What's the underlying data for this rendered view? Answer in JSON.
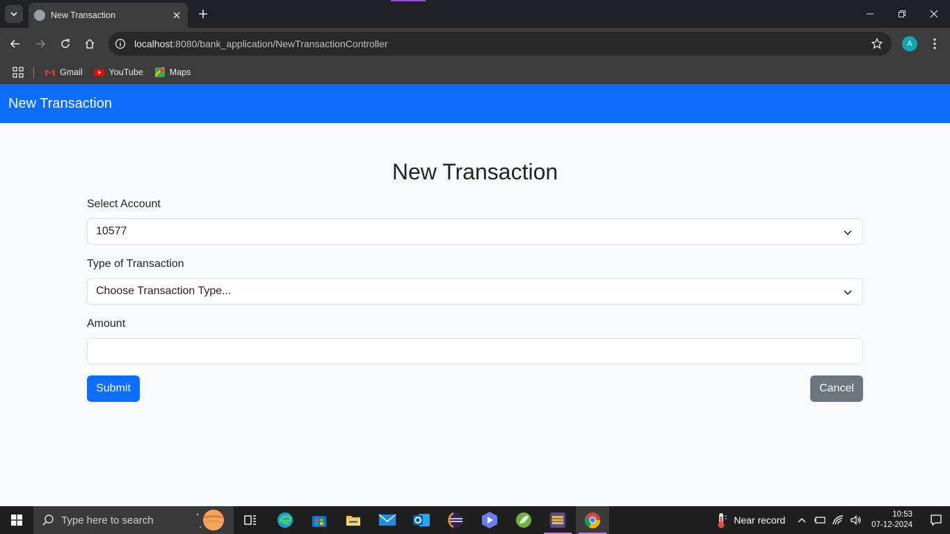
{
  "browser": {
    "tab_title": "New Transaction",
    "url_host": "localhost",
    "url_rest": ":8080/bank_application/NewTransactionController",
    "profile_initial": "A",
    "bookmarks": [
      {
        "label": "Gmail",
        "icon": "gmail-icon"
      },
      {
        "label": "YouTube",
        "icon": "youtube-icon"
      },
      {
        "label": "Maps",
        "icon": "maps-icon"
      }
    ]
  },
  "page": {
    "brand": "New Transaction",
    "title": "New Transaction",
    "form": {
      "account_label": "Select Account",
      "account_value": "10577",
      "type_label": "Type of Transaction",
      "type_value": "Choose Transaction Type...",
      "amount_label": "Amount",
      "amount_value": "",
      "submit_label": "Submit",
      "cancel_label": "Cancel"
    }
  },
  "taskbar": {
    "search_placeholder": "Type here to search",
    "apps": [
      "task-view-icon",
      "edge-icon",
      "store-icon",
      "file-explorer-icon",
      "mail-icon",
      "outlook-icon",
      "eclipse-icon",
      "app-icon",
      "spring-icon",
      "jar-app-icon",
      "chrome-icon"
    ],
    "weather_text": "Near record",
    "time": "10:53",
    "date": "07-12-2024"
  },
  "colors": {
    "primary": "#0d6efd",
    "secondary": "#6c757d",
    "page_bg": "#f8f9fa"
  }
}
